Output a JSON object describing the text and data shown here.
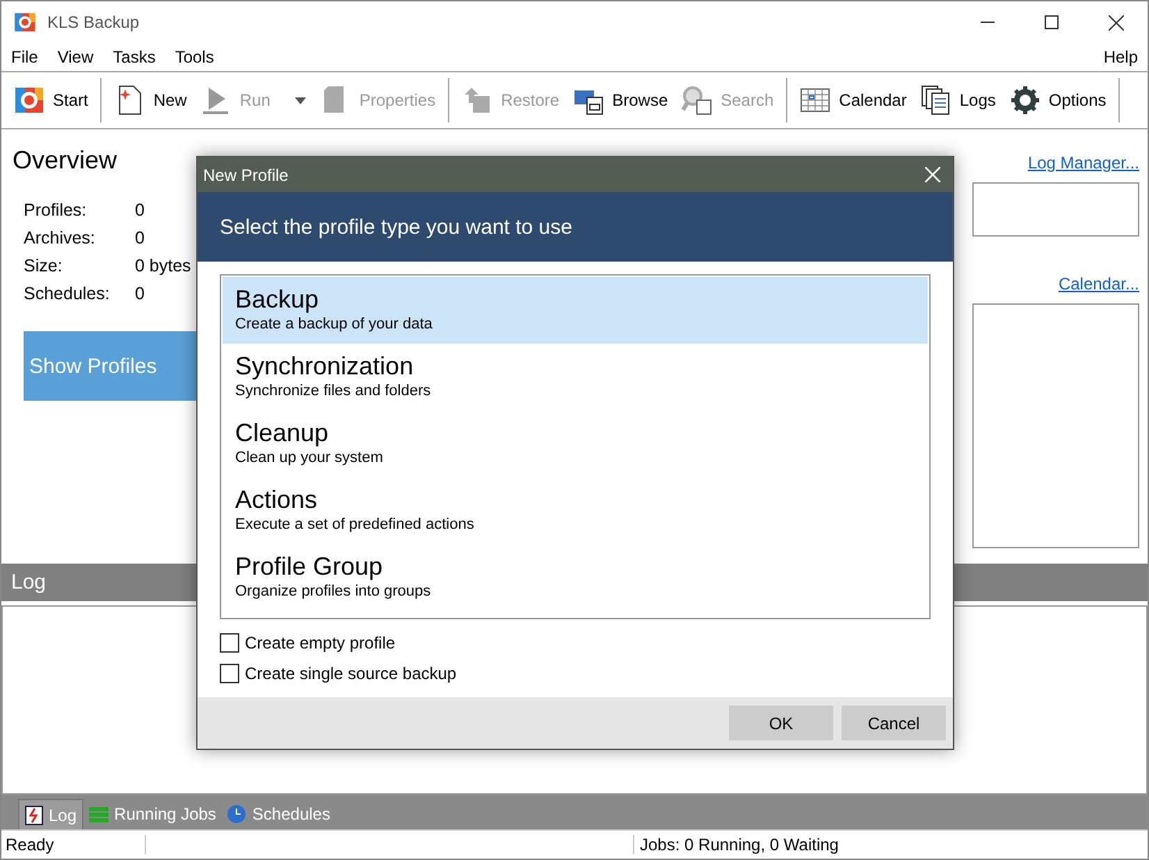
{
  "window": {
    "title": "KLS Backup"
  },
  "menu": {
    "items": [
      "File",
      "View",
      "Tasks",
      "Tools"
    ],
    "help": "Help"
  },
  "toolbar": [
    {
      "kind": "button",
      "label": "Start",
      "disabled": false
    },
    {
      "kind": "separator"
    },
    {
      "kind": "button",
      "label": "New",
      "disabled": false
    },
    {
      "kind": "split",
      "label": "Run",
      "disabled": true
    },
    {
      "kind": "button",
      "label": "Properties",
      "disabled": true
    },
    {
      "kind": "separator"
    },
    {
      "kind": "button",
      "label": "Restore",
      "disabled": true
    },
    {
      "kind": "button",
      "label": "Browse",
      "disabled": false
    },
    {
      "kind": "button",
      "label": "Search",
      "disabled": true
    },
    {
      "kind": "separator"
    },
    {
      "kind": "button",
      "label": "Calendar",
      "disabled": false
    },
    {
      "kind": "button",
      "label": "Logs",
      "disabled": false
    },
    {
      "kind": "button",
      "label": "Options",
      "disabled": false
    },
    {
      "kind": "separator"
    }
  ],
  "overview": {
    "title": "Overview",
    "stats": [
      {
        "label": "Profiles:",
        "value": "0"
      },
      {
        "label": "Archives:",
        "value": "0"
      },
      {
        "label": "Size:",
        "value": "0 bytes"
      },
      {
        "label": "Schedules:",
        "value": "0"
      }
    ],
    "button": "Show Profiles"
  },
  "links": [
    "Log Manager...",
    "Calendar..."
  ],
  "log": {
    "title": "Log"
  },
  "bottom_tabs": [
    {
      "label": "Log",
      "selected": true
    },
    {
      "label": "Running Jobs",
      "selected": false
    },
    {
      "label": "Schedules",
      "selected": false
    }
  ],
  "status_bar": [
    "Ready",
    "Jobs: 0 Running, 0 Waiting"
  ],
  "dialog": {
    "title": "New Profile",
    "heading": "Select the profile type you want to use",
    "types": [
      {
        "name": "Backup",
        "description": "Create a backup of your data",
        "selected": true
      },
      {
        "name": "Synchronization",
        "description": "Synchronize files and folders",
        "selected": false
      },
      {
        "name": "Cleanup",
        "description": "Clean up your system",
        "selected": false
      },
      {
        "name": "Actions",
        "description": "Execute a set of predefined actions",
        "selected": false
      },
      {
        "name": "Profile Group",
        "description": "Organize profiles into groups",
        "selected": false
      }
    ],
    "options": [
      {
        "label": "Create empty profile",
        "checked": false
      },
      {
        "label": "Create single source backup",
        "checked": false
      }
    ],
    "buttons": [
      "OK",
      "Cancel"
    ]
  }
}
